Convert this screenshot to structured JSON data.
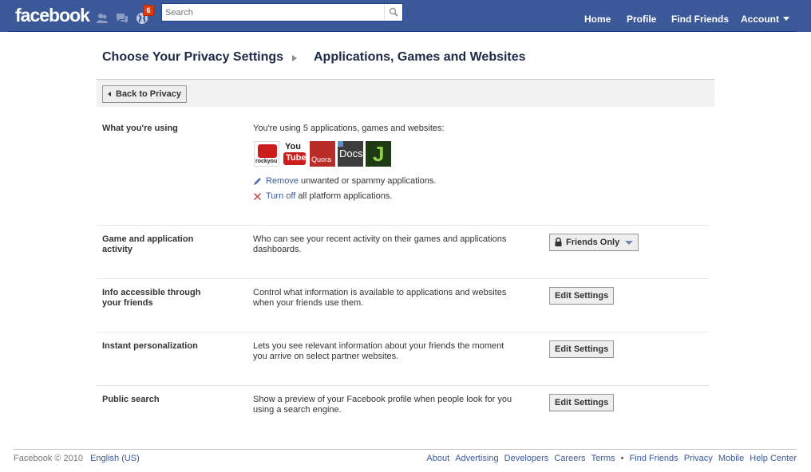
{
  "header": {
    "logo": "facebook",
    "notification_count": "6",
    "search_placeholder": "Search",
    "nav": [
      "Home",
      "Profile",
      "Find Friends",
      "Account"
    ],
    "brand_color": "#3b5998"
  },
  "page": {
    "title": "Choose Your Privacy Settings",
    "subtitle": "Applications, Games and Websites",
    "back_button": "Back to Privacy"
  },
  "using": {
    "label": "What you're using",
    "description": "You're using 5 applications, games and websites:",
    "apps": [
      {
        "name": "rockyou",
        "icon": "rockyou-icon",
        "color": "#cc1d1d"
      },
      {
        "name": "YouTube",
        "icon": "youtube-icon",
        "color": "#ffffff"
      },
      {
        "name": "Quora",
        "icon": "quora-icon",
        "color": "#b92b27"
      },
      {
        "name": "Docs",
        "icon": "docs-icon",
        "color": "#333333"
      },
      {
        "name": "J",
        "icon": "j-app-icon",
        "color": "#2f7a1b"
      }
    ],
    "remove_link": "Remove",
    "remove_text": "unwanted or spammy applications.",
    "turnoff_link": "Turn off",
    "turnoff_text": "all platform applications."
  },
  "settings": [
    {
      "label_line1": "Game and application",
      "label_line2": "activity",
      "desc_line1": "Who can see your recent activity on their games and applications",
      "desc_line2": "dashboards.",
      "control": "Friends Only"
    },
    {
      "label_line1": "Info accessible through",
      "label_line2": "your friends",
      "desc_line1": "Control what information is available to applications and websites",
      "desc_line2": "when your friends use them.",
      "control": "Edit Settings"
    },
    {
      "label_line1": "Instant personalization",
      "label_line2": "",
      "desc_line1": "Lets you see relevant information about your friends the moment",
      "desc_line2": "you arrive on select partner websites.",
      "control": "Edit Settings"
    },
    {
      "label_line1": "Public search",
      "label_line2": "",
      "desc_line1": "Show a preview of your Facebook profile when people look for you",
      "desc_line2": "using a search engine.",
      "control": "Edit Settings"
    }
  ],
  "footer": {
    "copyright": "Facebook © 2010",
    "language": "English (US)",
    "links_a": [
      "About",
      "Advertising",
      "Developers",
      "Careers",
      "Terms"
    ],
    "links_b": [
      "Find Friends",
      "Privacy",
      "Mobile",
      "Help Center"
    ],
    "separator": "•"
  }
}
